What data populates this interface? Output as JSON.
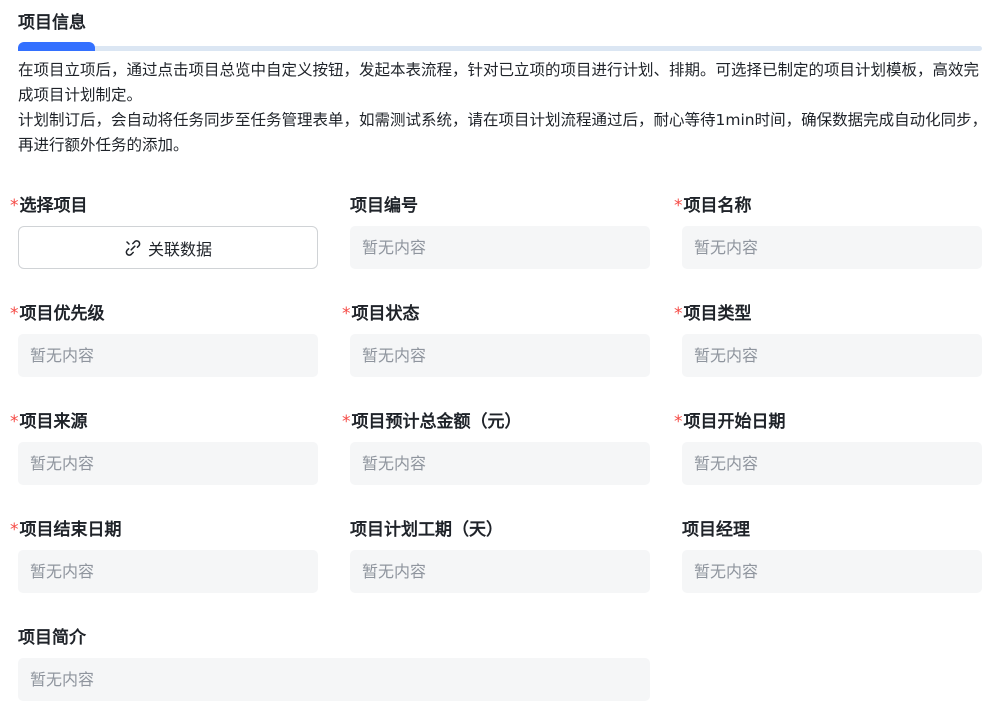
{
  "section": {
    "title": "项目信息"
  },
  "description": {
    "paragraph_1": "在项目立项后，通过点击项目总览中自定义按钮，发起本表流程，针对已立项的项目进行计划、排期。可选择已制定的项目计划模板，高效完成项目计划制定。",
    "paragraph_2": "计划制订后，会自动将任务同步至任务管理表单，如需测试系统，请在项目计划流程通过后，耐心等待1min时间，确保数据完成自动化同步，再进行额外任务的添加。"
  },
  "required_marker": "*",
  "empty_placeholder": "暂无内容",
  "fields": {
    "select_project": {
      "label": "选择项目",
      "required": true,
      "button_label": "关联数据",
      "button_icon": "link-icon"
    },
    "project_no": {
      "label": "项目编号",
      "required": false,
      "value": "暂无内容"
    },
    "project_name": {
      "label": "项目名称",
      "required": true,
      "value": "暂无内容"
    },
    "priority": {
      "label": "项目优先级",
      "required": true,
      "value": "暂无内容"
    },
    "status": {
      "label": "项目状态",
      "required": true,
      "value": "暂无内容"
    },
    "type": {
      "label": "项目类型",
      "required": true,
      "value": "暂无内容"
    },
    "source": {
      "label": "项目来源",
      "required": true,
      "value": "暂无内容"
    },
    "budget": {
      "label": "项目预计总金额（元）",
      "required": true,
      "value": "暂无内容"
    },
    "start_date": {
      "label": "项目开始日期",
      "required": true,
      "value": "暂无内容"
    },
    "end_date": {
      "label": "项目结束日期",
      "required": true,
      "value": "暂无内容"
    },
    "duration": {
      "label": "项目计划工期（天）",
      "required": false,
      "value": "暂无内容"
    },
    "manager": {
      "label": "项目经理",
      "required": false,
      "value": "暂无内容"
    },
    "summary": {
      "label": "项目简介",
      "required": false,
      "value": "暂无内容"
    }
  },
  "colors": {
    "accent": "#3370ff",
    "required": "#f54a45",
    "field_bg": "#f5f6f7",
    "placeholder": "#8f959e"
  }
}
